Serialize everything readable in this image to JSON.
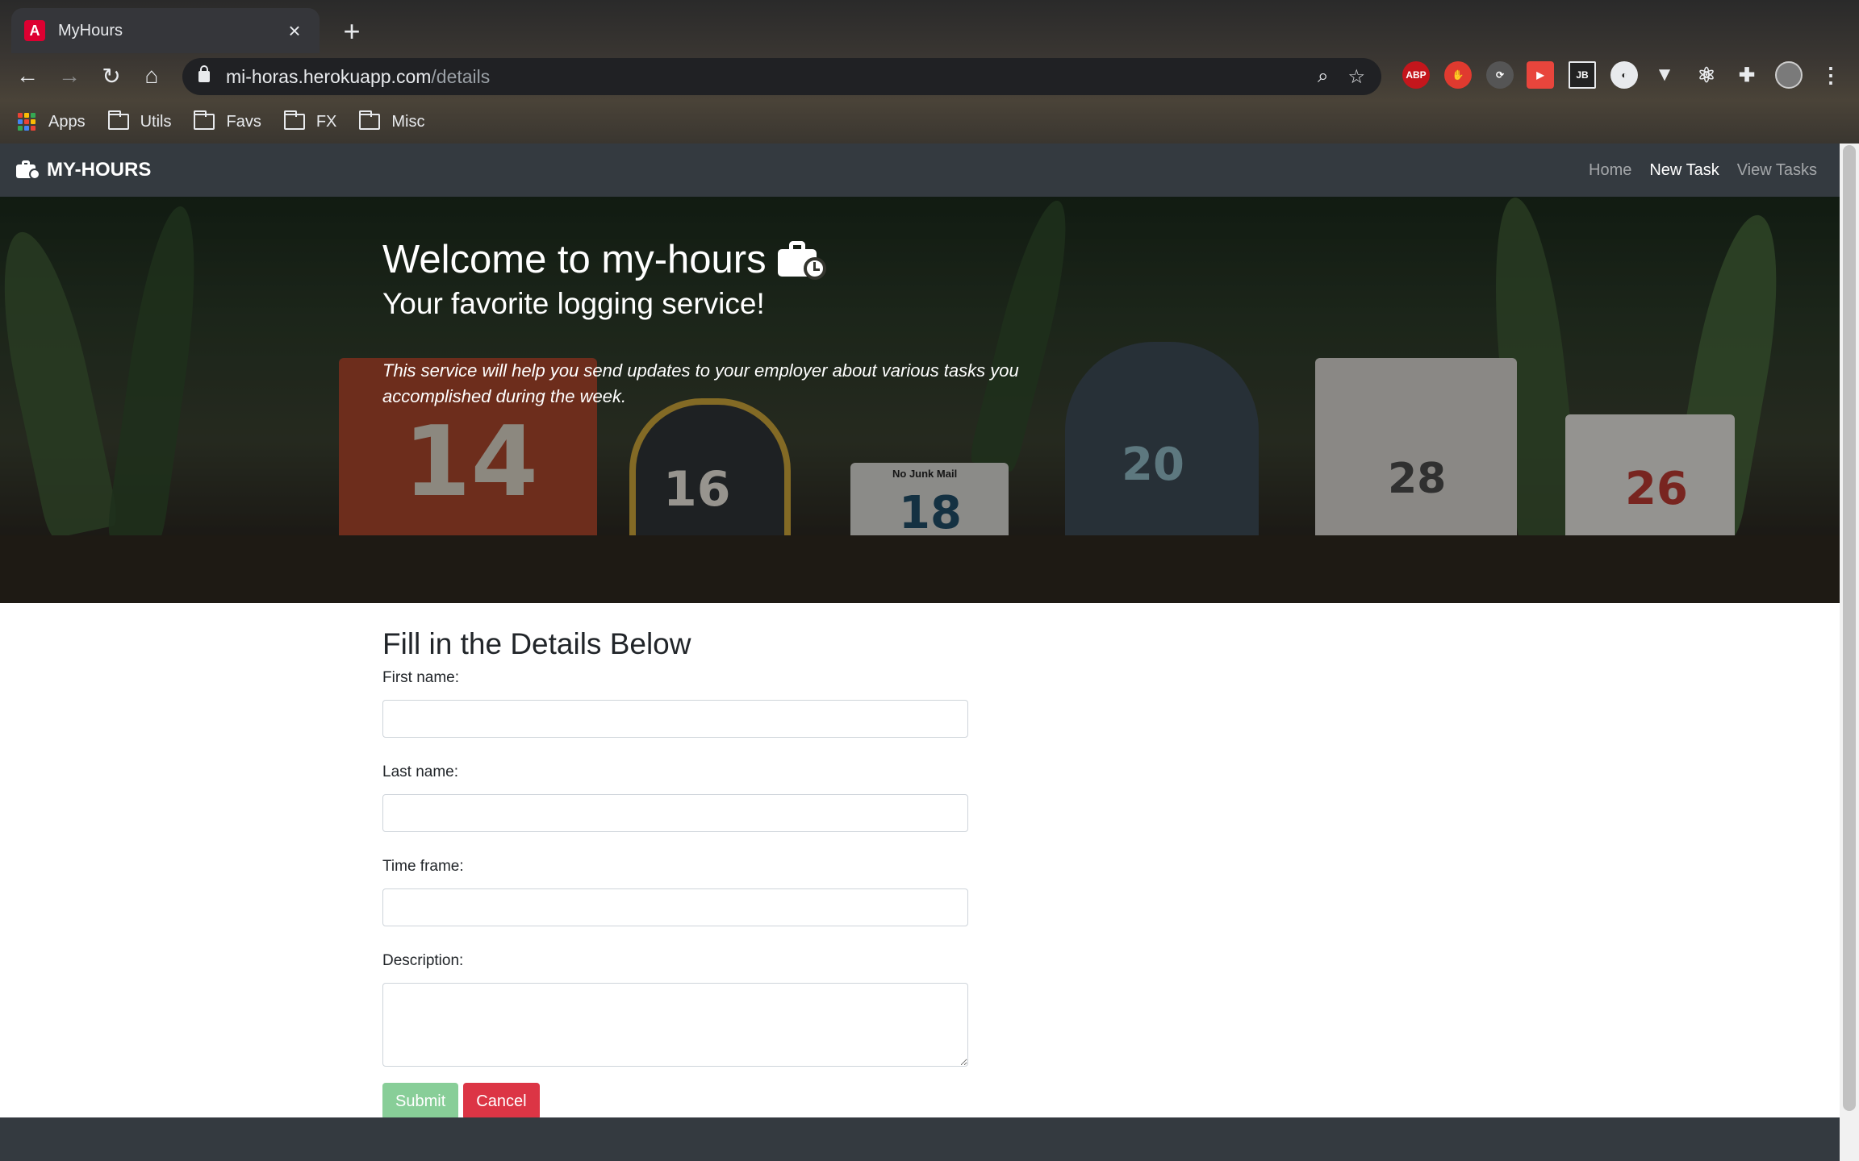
{
  "browser": {
    "tab_title": "MyHours",
    "tab_close": "×",
    "new_tab": "+",
    "url_host": "mi-horas.herokuapp.com",
    "url_path": "/details",
    "bookmarks": [
      "Apps",
      "Utils",
      "Favs",
      "FX",
      "Misc"
    ]
  },
  "navbar": {
    "brand": "MY-HOURS",
    "links": [
      "Home",
      "New Task",
      "View Tasks"
    ],
    "active_link": "New Task"
  },
  "hero": {
    "title": "Welcome to my-hours",
    "subtitle": "Your favorite logging service!",
    "lead": "This service will help you send updates to your employer about various tasks you accomplished during the week.",
    "mailbox_numbers": [
      "14",
      "16",
      "18",
      "20",
      "28",
      "26"
    ],
    "mailbox_sign": "No Junk Mail"
  },
  "form": {
    "heading": "Fill in the Details Below",
    "first_name_label": "First name:",
    "last_name_label": "Last name:",
    "time_frame_label": "Time frame:",
    "description_label": "Description:",
    "first_name_value": "",
    "last_name_value": "",
    "time_frame_value": "",
    "description_value": "",
    "submit_label": "Submit",
    "cancel_label": "Cancel"
  },
  "colors": {
    "navbar_bg": "#343a40",
    "submit_bg": "#28a745",
    "cancel_bg": "#dc3545"
  }
}
